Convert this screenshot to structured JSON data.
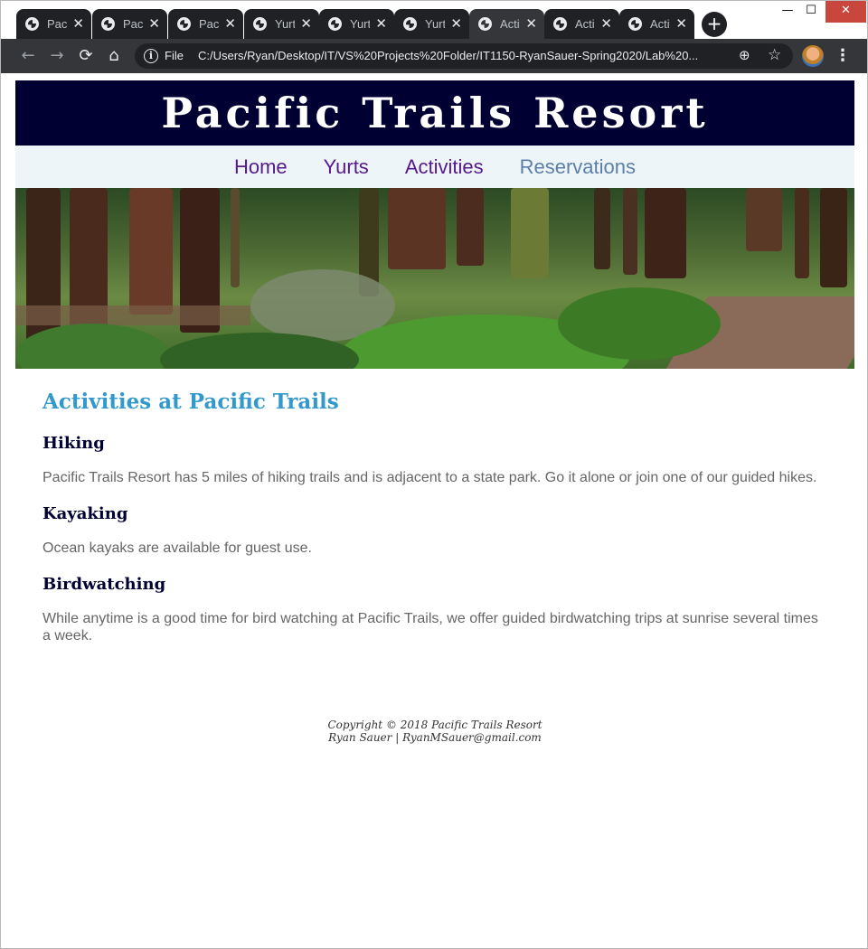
{
  "browser": {
    "tabs": [
      {
        "title": "Pacific Trails Resort",
        "active": false
      },
      {
        "title": "Pacific Trails Resort",
        "active": false
      },
      {
        "title": "Pacific Trails Resort",
        "active": false
      },
      {
        "title": "Yurts",
        "active": false
      },
      {
        "title": "Yurts",
        "active": false
      },
      {
        "title": "Yurts",
        "active": false
      },
      {
        "title": "Activities",
        "active": true
      },
      {
        "title": "Activities",
        "active": false
      },
      {
        "title": "Activities",
        "active": false
      }
    ],
    "new_tab_label": "+",
    "window_controls": {
      "minimize": "—",
      "maximize": "☐",
      "close": "✕"
    },
    "nav": {
      "back": "←",
      "forward": "→",
      "reload": "⟳",
      "home": "⌂"
    },
    "address": {
      "scheme_label": "File",
      "url": "C:/Users/Ryan/Desktop/IT/VS%20Projects%20Folder/IT1150-RyanSauer-Spring2020/Lab%20..."
    },
    "icons": {
      "info": "i",
      "zoom": "⊕",
      "star": "☆",
      "menu": "⋮"
    }
  },
  "site": {
    "brand": "Pacific Trails Resort",
    "nav": [
      {
        "label": "Home",
        "current": false
      },
      {
        "label": "Yurts",
        "current": false
      },
      {
        "label": "Activities",
        "current": false
      },
      {
        "label": "Reservations",
        "current": true
      }
    ]
  },
  "content": {
    "heading": "Activities at Pacific Trails",
    "sections": [
      {
        "title": "Hiking",
        "text": "Pacific Trails Resort has 5 miles of hiking trails and is adjacent to a state park. Go it alone or join one of our guided hikes."
      },
      {
        "title": "Kayaking",
        "text": "Ocean kayaks are available for guest use."
      },
      {
        "title": "Birdwatching",
        "text": "While anytime is a good time for bird watching at Pacific Trails, we offer guided birdwatching trips at sunrise several times a week."
      }
    ]
  },
  "footer": {
    "copyright": "Copyright © 2018 Pacific Trails Resort",
    "author_line": "Ryan Sauer | RyanMSauer@gmail.com"
  },
  "colors": {
    "brand_bg": "#000033",
    "nav_bg": "#eef5f8",
    "nav_link": "#551a8b",
    "nav_current": "#5c7fa8",
    "h2": "#3399cc",
    "h3": "#000033",
    "body_text": "#666666"
  }
}
